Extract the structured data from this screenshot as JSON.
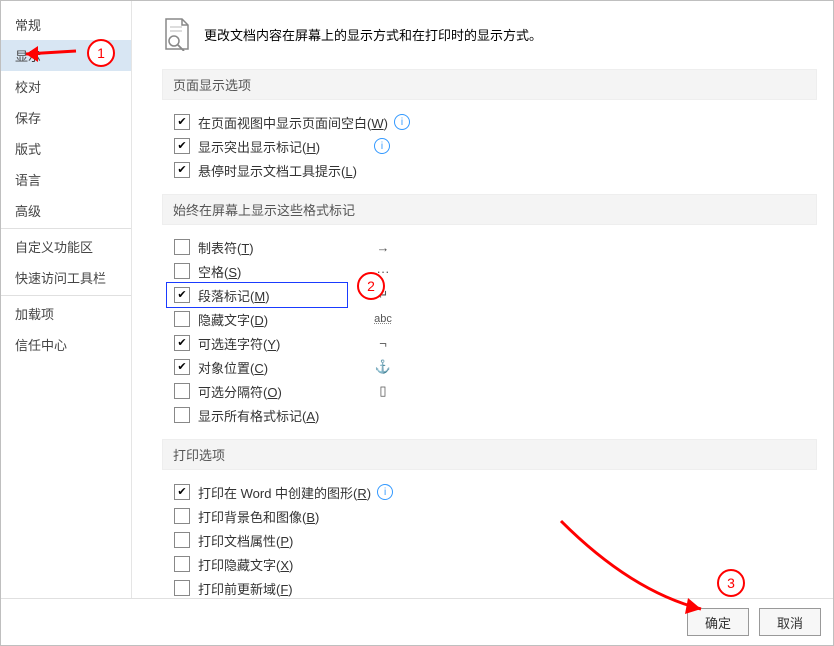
{
  "sidebar": {
    "items": [
      {
        "label": "常规",
        "selected": false
      },
      {
        "label": "显示",
        "selected": true
      },
      {
        "label": "校对",
        "selected": false
      },
      {
        "label": "保存",
        "selected": false
      },
      {
        "label": "版式",
        "selected": false
      },
      {
        "label": "语言",
        "selected": false
      },
      {
        "label": "高级",
        "selected": false
      }
    ],
    "items2": [
      {
        "label": "自定义功能区"
      },
      {
        "label": "快速访问工具栏"
      }
    ],
    "items3": [
      {
        "label": "加载项"
      },
      {
        "label": "信任中心"
      }
    ]
  },
  "header": {
    "text": "更改文档内容在屏幕上的显示方式和在打印时的显示方式。"
  },
  "sections": {
    "page_display": "页面显示选项",
    "formatting_marks": "始终在屏幕上显示这些格式标记",
    "print_options": "打印选项"
  },
  "page_display_opts": [
    {
      "text": "在页面视图中显示页面间空白",
      "mn": "W",
      "checked": true,
      "info": true
    },
    {
      "text": "显示突出显示标记",
      "mn": "H",
      "checked": true,
      "info": true
    },
    {
      "text": "悬停时显示文档工具提示",
      "mn": "L",
      "checked": true,
      "info": false
    }
  ],
  "formatting_opts": [
    {
      "text": "制表符",
      "mn": "T",
      "checked": false,
      "sym": "→"
    },
    {
      "text": "空格",
      "mn": "S",
      "checked": false,
      "sym": "···"
    },
    {
      "text": "段落标记",
      "mn": "M",
      "checked": true,
      "sym": "↵"
    },
    {
      "text": "隐藏文字",
      "mn": "D",
      "checked": false,
      "sym": "abc"
    },
    {
      "text": "可选连字符",
      "mn": "Y",
      "checked": true,
      "sym": "¬"
    },
    {
      "text": "对象位置",
      "mn": "C",
      "checked": true,
      "sym": "⚓"
    },
    {
      "text": "可选分隔符",
      "mn": "O",
      "checked": false,
      "sym": "▯"
    },
    {
      "text": "显示所有格式标记",
      "mn": "A",
      "checked": false,
      "sym": ""
    }
  ],
  "print_opts": [
    {
      "text": "打印在 Word 中创建的图形",
      "mn": "R",
      "checked": true,
      "info": true
    },
    {
      "text": "打印背景色和图像",
      "mn": "B",
      "checked": false,
      "info": false
    },
    {
      "text": "打印文档属性",
      "mn": "P",
      "checked": false,
      "info": false
    },
    {
      "text": "打印隐藏文字",
      "mn": "X",
      "checked": false,
      "info": false
    },
    {
      "text": "打印前更新域",
      "mn": "F",
      "checked": false,
      "info": false
    }
  ],
  "footer": {
    "ok": "确定",
    "cancel": "取消"
  },
  "callouts": {
    "c1": "1",
    "c2": "2",
    "c3": "3"
  },
  "colors": {
    "accent_blue": "#d8e6f3",
    "annotation": "#ff0000",
    "highlight": "#1a3bff"
  }
}
